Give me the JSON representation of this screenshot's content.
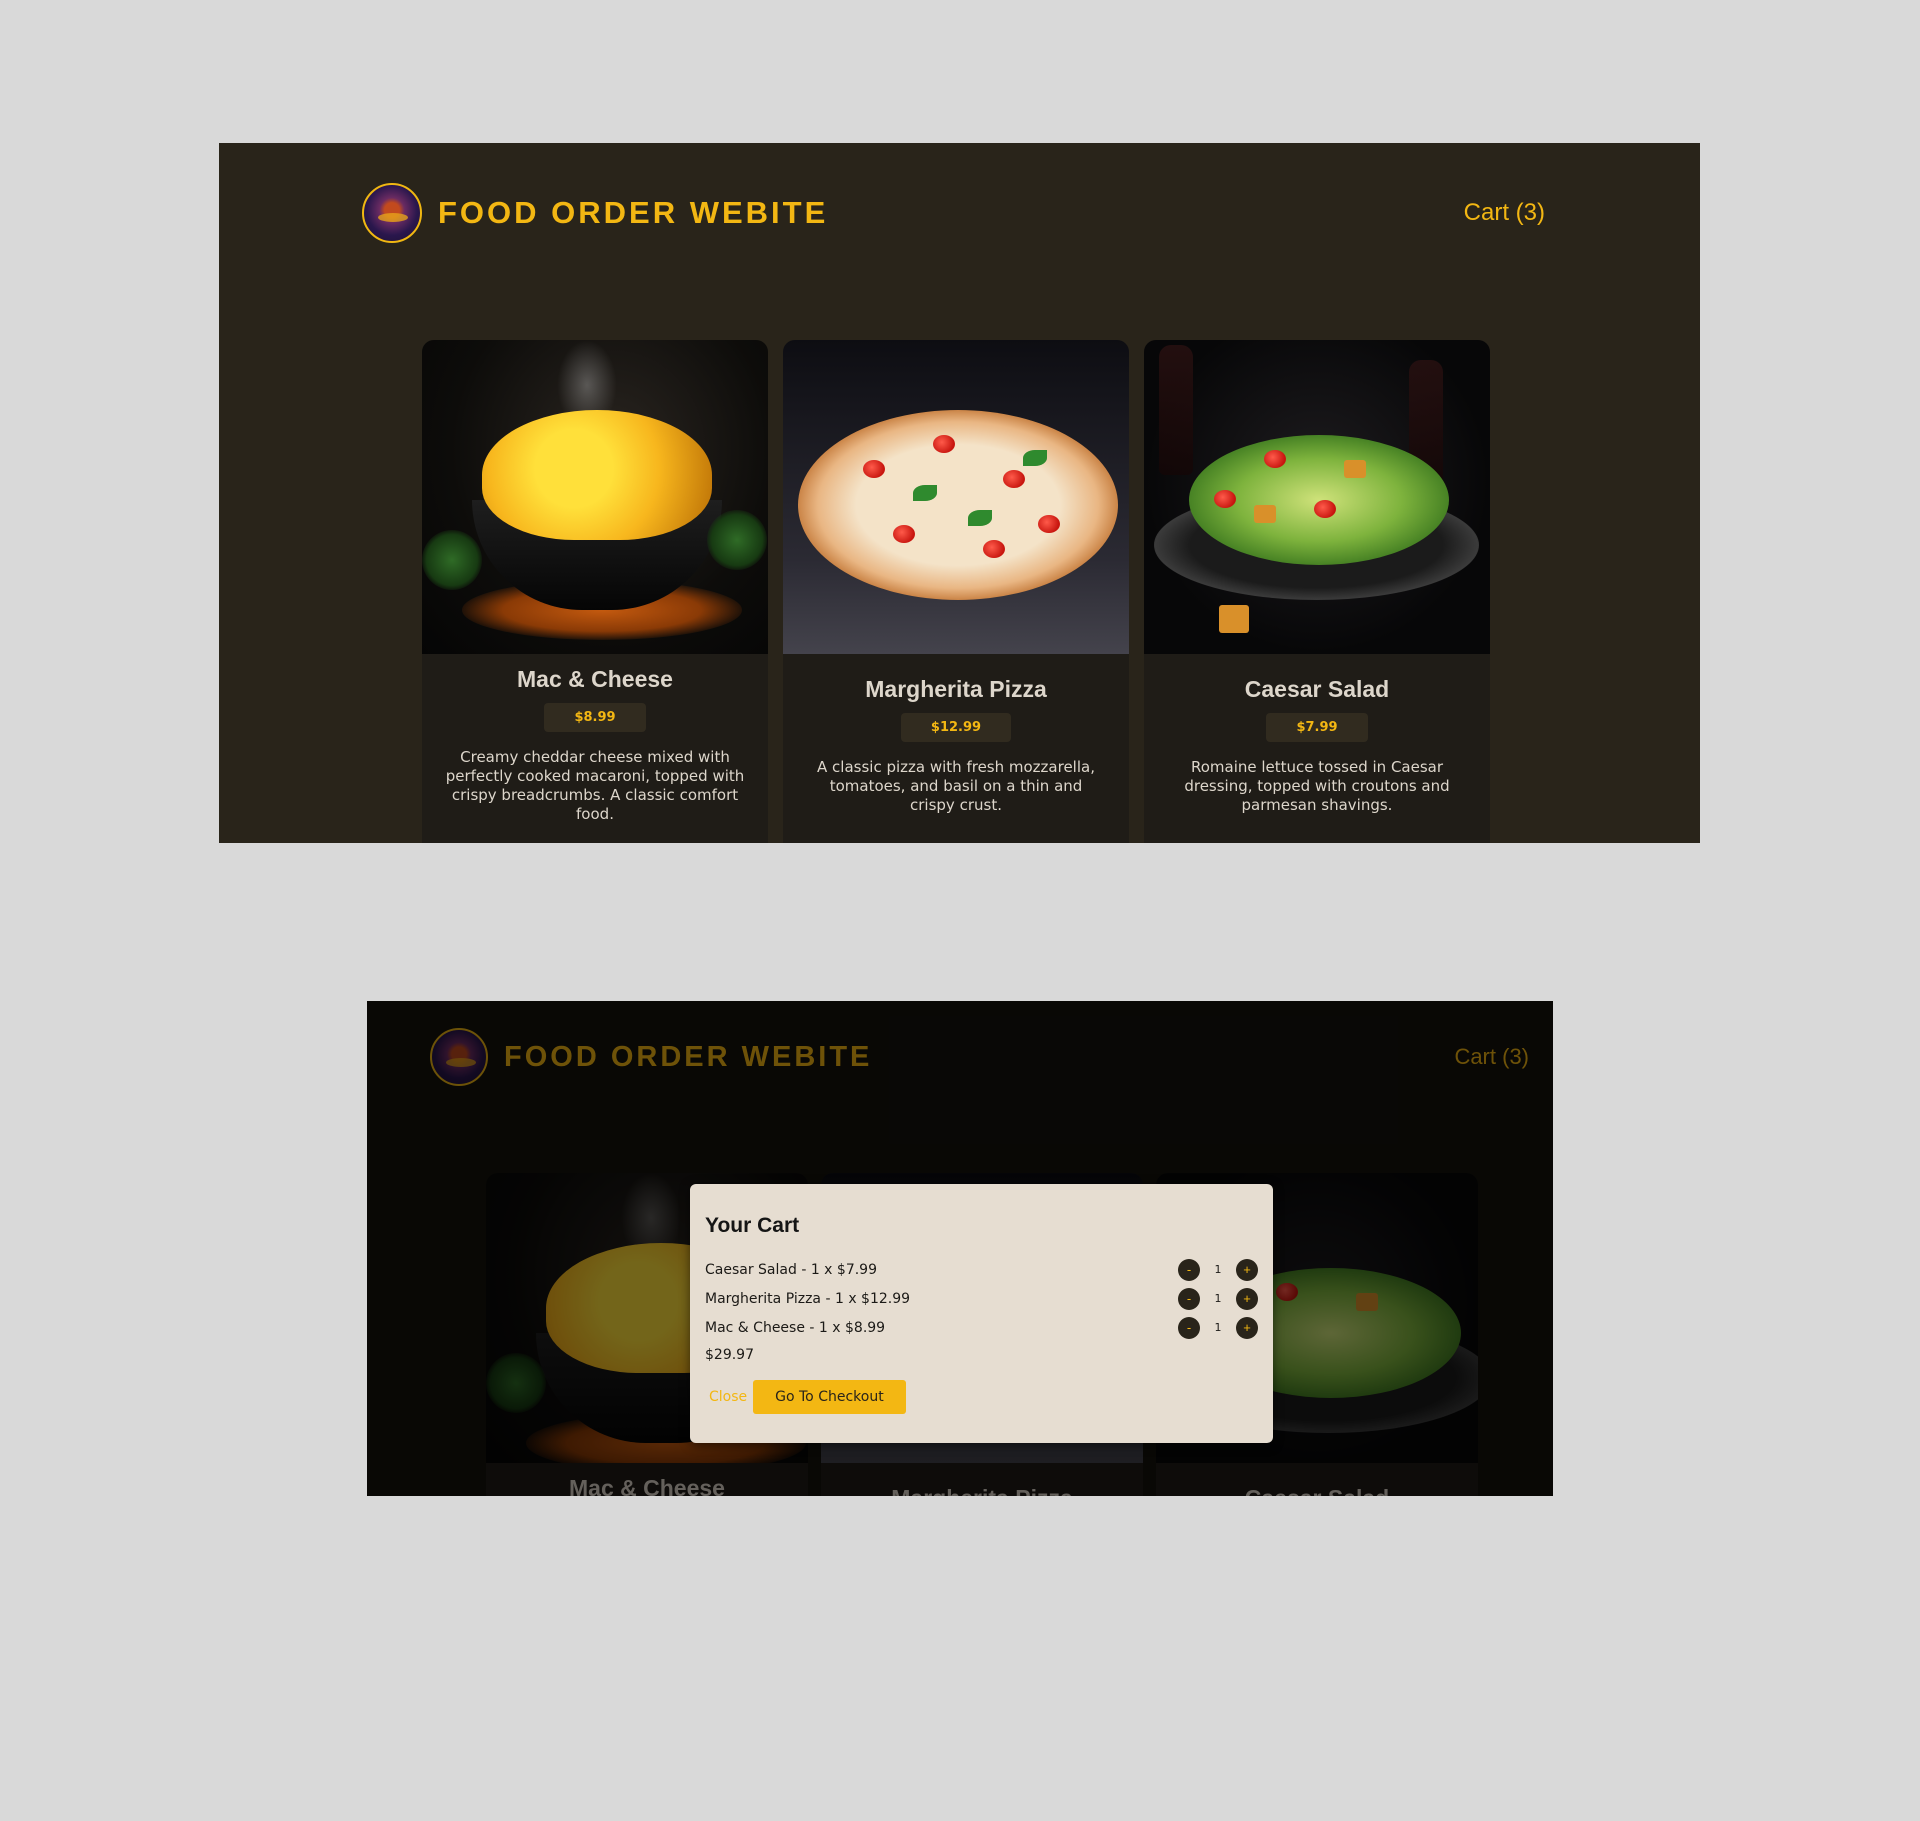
{
  "header": {
    "title": "FOOD ORDER WEBITE",
    "cart_label": "Cart (3)"
  },
  "meals": [
    {
      "name": "Mac & Cheese",
      "price": "$8.99",
      "description": "Creamy cheddar cheese mixed with perfectly cooked macaroni, topped with crispy breadcrumbs. A classic comfort food."
    },
    {
      "name": "Margherita Pizza",
      "price": "$12.99",
      "description": "A classic pizza with fresh mozzarella, tomatoes, and basil on a thin and crispy crust."
    },
    {
      "name": "Caesar Salad",
      "price": "$7.99",
      "description": "Romaine lettuce tossed in Caesar dressing, topped with croutons and parmesan shavings."
    }
  ],
  "cart_modal": {
    "title": "Your Cart",
    "items": [
      {
        "label": "Caesar Salad - 1 x $7.99",
        "quantity": "1"
      },
      {
        "label": "Margherita Pizza - 1 x $12.99",
        "quantity": "1"
      },
      {
        "label": "Mac & Cheese - 1 x $8.99",
        "quantity": "1"
      }
    ],
    "decrease_symbol": "-",
    "increase_symbol": "+",
    "total": "$29.97",
    "close_label": "Close",
    "checkout_label": "Go To Checkout"
  },
  "colors": {
    "accent": "#f3b713",
    "background": "#29241a",
    "card": "#1f1c17",
    "modal": "#e6ddd1",
    "page": "#d9d9d9"
  },
  "icons": {
    "logo": "food-logo-icon"
  }
}
